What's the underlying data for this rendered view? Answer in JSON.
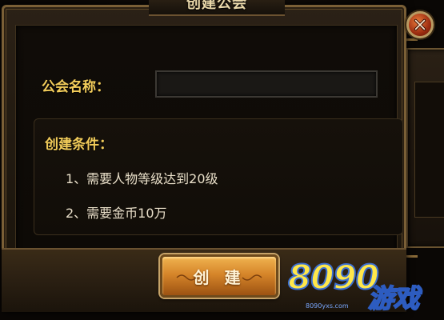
{
  "dialog": {
    "title": "创建公会",
    "name_label": "公会名称：",
    "name_input_value": "",
    "conditions": {
      "title": "创建条件：",
      "items": [
        "1、需要人物等级达到20级",
        "2、需要金币10万"
      ]
    },
    "create_button": "创 建",
    "close_icon": "close-x-icon"
  },
  "watermark": {
    "logo_text": "8090",
    "logo_text2": "游戏",
    "url": "8090yxs.com"
  },
  "colors": {
    "label_gold": "#f2cc5a",
    "button_orange": "#d6862a",
    "close_red": "#9c2c10"
  }
}
